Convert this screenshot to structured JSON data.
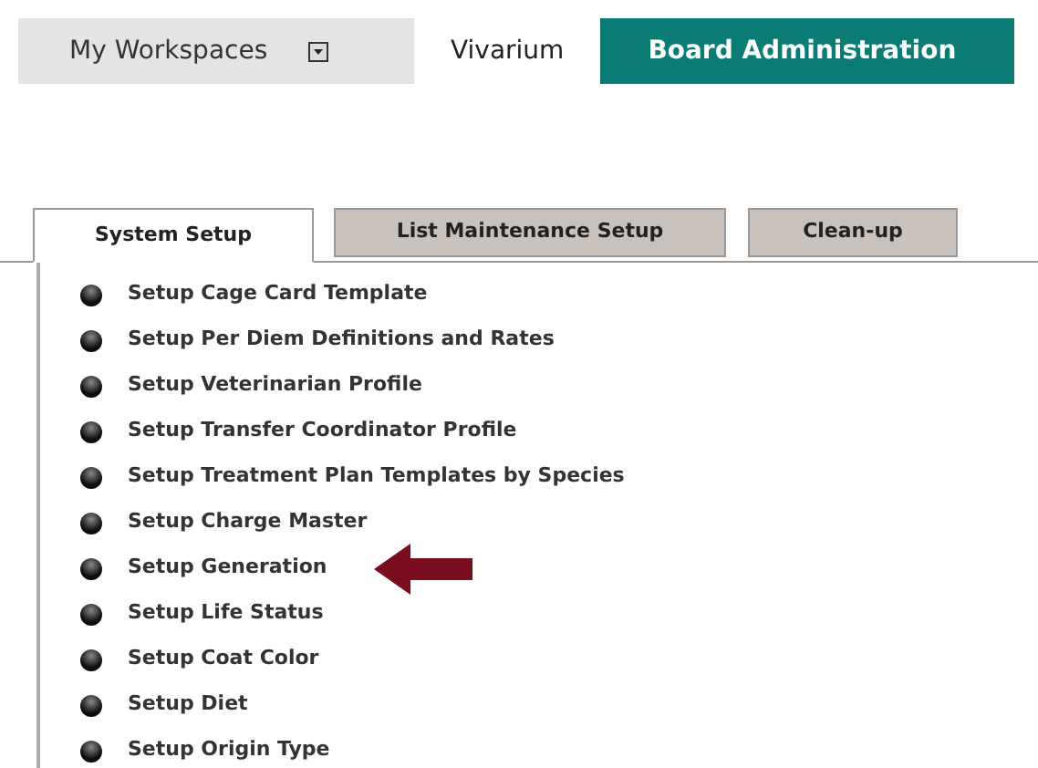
{
  "top_nav": [
    {
      "label": "My Workspaces",
      "kind": "menu",
      "selected": false
    },
    {
      "label": "Vivarium",
      "kind": "link",
      "selected": false
    },
    {
      "label": "Board Administration",
      "kind": "link",
      "selected": true
    }
  ],
  "tabs": [
    {
      "label": "System Setup",
      "selected": true
    },
    {
      "label": "List Maintenance Setup",
      "selected": false
    },
    {
      "label": "Clean-up",
      "selected": false
    }
  ],
  "items": [
    {
      "label": "Setup Cage Card Template",
      "arrow": false
    },
    {
      "label": "Setup Per Diem Definitions and Rates",
      "arrow": false
    },
    {
      "label": "Setup Veterinarian Profile",
      "arrow": false
    },
    {
      "label": "Setup Transfer Coordinator Profile",
      "arrow": false
    },
    {
      "label": "Setup Treatment Plan Templates by Species",
      "arrow": false
    },
    {
      "label": "Setup Charge Master",
      "arrow": false
    },
    {
      "label": "Setup Generation",
      "arrow": true
    },
    {
      "label": "Setup Life Status",
      "arrow": false
    },
    {
      "label": "Setup Coat Color",
      "arrow": false
    },
    {
      "label": "Setup Diet",
      "arrow": false
    },
    {
      "label": "Setup Origin Type",
      "arrow": false
    }
  ]
}
